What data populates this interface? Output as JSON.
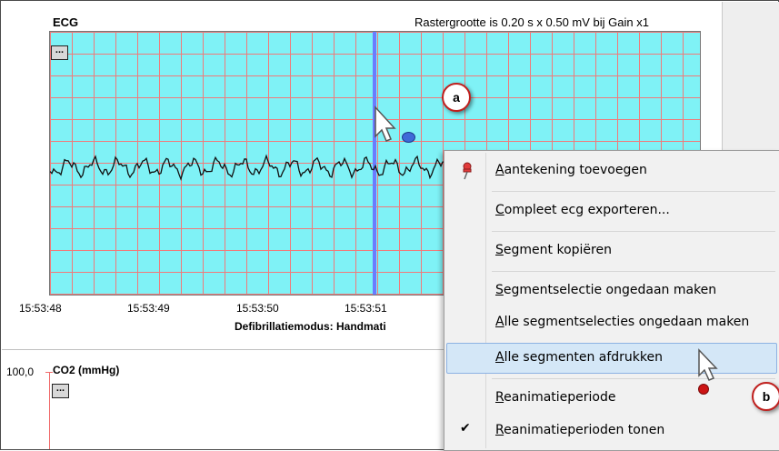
{
  "ecg": {
    "title": "ECG",
    "grid_info": "Rastergrootte is 0.20 s x 0.50 mV bij Gain x1",
    "tool_button": "...",
    "time_ticks": [
      "15:53:48",
      "15:53:49",
      "15:53:50",
      "15:53:51"
    ],
    "mode_label": "Defibrillatiemodus: Handmati"
  },
  "co2": {
    "title": "CO2 (mmHg)",
    "axis_max": "100,0",
    "tool_button": "..."
  },
  "callouts": {
    "a": "a",
    "b": "b"
  },
  "context_menu": {
    "items": [
      {
        "label": "Aantekening toevoegen",
        "icon": "pushpin-icon"
      },
      {
        "label": "Compleet ecg exporteren..."
      },
      {
        "label": "Segment kopiëren"
      },
      {
        "label": "Segmentselectie ongedaan maken"
      },
      {
        "label": "Alle segmentselecties ongedaan maken"
      },
      {
        "label": "Alle segmenten afdrukken",
        "highlighted": true
      },
      {
        "label": "Reanimatieperiode"
      },
      {
        "label": "Reanimatieperioden tonen",
        "checked": true
      }
    ]
  },
  "colors": {
    "grid_background": "#7ff2f6",
    "grid_lines": "#f07a7a",
    "cursor_line": "#6a7cff",
    "callout_border": "#c0201e",
    "menu_highlight": "#d4e7f7"
  }
}
